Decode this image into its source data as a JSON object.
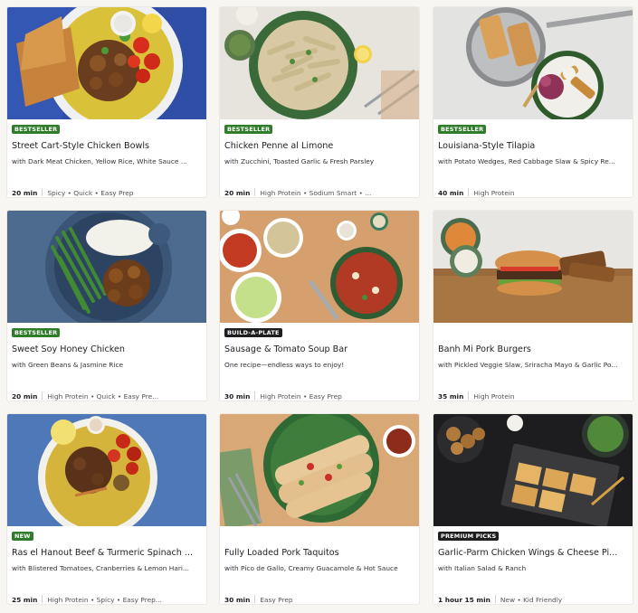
{
  "recipes": [
    {
      "badge": "BESTSELLER",
      "title": "Street Cart-Style Chicken Bowls",
      "subtitle": "with Dark Meat Chicken, Yellow Rice, White Sauce ...",
      "time": "20 min",
      "tags": "Spicy • Quick • Easy Prep"
    },
    {
      "badge": "BESTSELLER",
      "title": "Chicken Penne al Limone",
      "subtitle": "with Zucchini, Toasted Garlic & Fresh Parsley",
      "time": "20 min",
      "tags": "High Protein • Sodium Smart • ..."
    },
    {
      "badge": "BESTSELLER",
      "title": "Louisiana-Style Tilapia",
      "subtitle": "with Potato Wedges, Red Cabbage Slaw & Spicy Re...",
      "time": "40 min",
      "tags": "High Protein"
    },
    {
      "badge": "BESTSELLER",
      "title": "Sweet Soy Honey Chicken",
      "subtitle": "with Green Beans & Jasmine Rice",
      "time": "20 min",
      "tags": "High Protein • Quick • Easy Pre..."
    },
    {
      "badge": "BUILD-A-PLATE",
      "title": "Sausage & Tomato Soup Bar",
      "subtitle": "One recipe—endless ways to enjoy!",
      "time": "30 min",
      "tags": "High Protein • Easy Prep"
    },
    {
      "badge": "",
      "title": "Banh Mi Pork Burgers",
      "subtitle": "with Pickled Veggie Slaw, Sriracha Mayo & Garlic Po...",
      "time": "35 min",
      "tags": "High Protein"
    },
    {
      "badge": "NEW",
      "title": "Ras el Hanout Beef & Turmeric Spinach ...",
      "subtitle": "with Blistered Tomatoes, Cranberries & Lemon Hari...",
      "time": "25 min",
      "tags": "High Protein • Spicy • Easy Prep..."
    },
    {
      "badge": "",
      "title": "Fully Loaded Pork Taquitos",
      "subtitle": "with Pico de Gallo, Creamy Guacamole & Hot Sauce",
      "time": "30 min",
      "tags": "Easy Prep"
    },
    {
      "badge": "PREMIUM PICKS",
      "title": "Garlic-Parm Chicken Wings & Cheese Pi...",
      "subtitle": "with Italian Salad & Ranch",
      "time": "1 hour 15 min",
      "tags": "New • Kid Friendly"
    }
  ],
  "colors": {
    "badge_green": "#2f7d2b",
    "badge_dark": "#1e1e1e",
    "background": "#f7f6f2"
  }
}
